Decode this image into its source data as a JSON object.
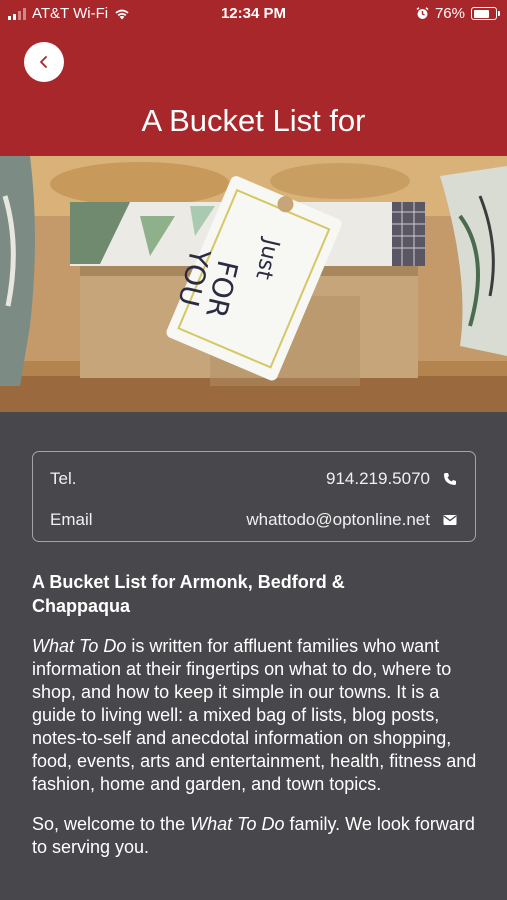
{
  "status_bar": {
    "carrier": "AT&T Wi-Fi",
    "time": "12:34 PM",
    "battery": "76%",
    "battery_level": 0.76
  },
  "header": {
    "title": "A Bucket List for",
    "bg_color": "#a8272a"
  },
  "hero": {
    "tag_line1": "Just",
    "tag_line2": "FOR",
    "tag_line3": "YOU"
  },
  "contact": {
    "tel_label": "Tel.",
    "tel_value": "914.219.5070",
    "email_label": "Email",
    "email_value": "whattodo@optonline.net"
  },
  "content": {
    "heading": "A Bucket List for Armonk, Bedford & Chappaqua",
    "p1_em": "What To Do",
    "p1_rest": " is written for affluent families who want information at their fingertips on what to do, where to shop, and how to keep it simple in our towns. It is a guide to living well: a mixed bag of lists, blog posts, notes-to-self and anecdotal information on shopping, food, events, arts and entertainment, health, fitness and fashion, home and garden, and town topics.",
    "p2_start": "So, welcome to the ",
    "p2_em": "What To Do",
    "p2_end": " family.  We look forward to serving you."
  }
}
